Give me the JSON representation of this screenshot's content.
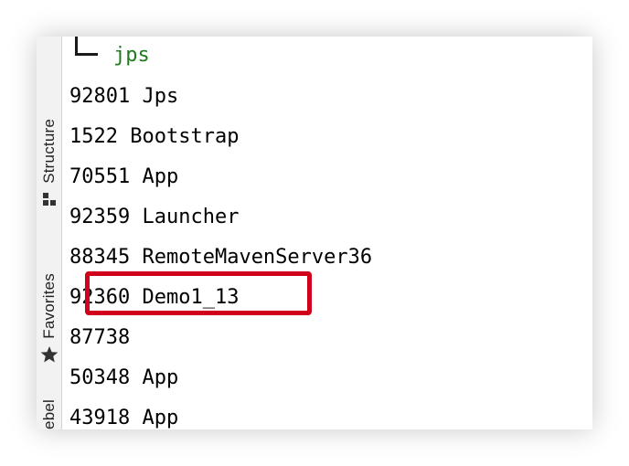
{
  "sidebar": {
    "tabs": [
      {
        "label": "Structure",
        "icon": "structure-icon"
      },
      {
        "label": "Favorites",
        "icon": "star-icon"
      },
      {
        "label": "ebel",
        "icon": ""
      }
    ]
  },
  "terminal": {
    "tree_command": "jps",
    "tree_command_color": "#1d7a1d",
    "processes": [
      {
        "pid": "92801",
        "name": "Jps"
      },
      {
        "pid": "1522",
        "name": "Bootstrap"
      },
      {
        "pid": "70551",
        "name": "App"
      },
      {
        "pid": "92359",
        "name": "Launcher"
      },
      {
        "pid": "88345",
        "name": "RemoteMavenServer36"
      },
      {
        "pid": "92360",
        "name": "Demo1_13",
        "highlighted": true
      },
      {
        "pid": "87738",
        "name": ""
      },
      {
        "pid": "50348",
        "name": "App"
      },
      {
        "pid": "43918",
        "name": "App"
      }
    ],
    "highlight_color": "#d0021b"
  }
}
